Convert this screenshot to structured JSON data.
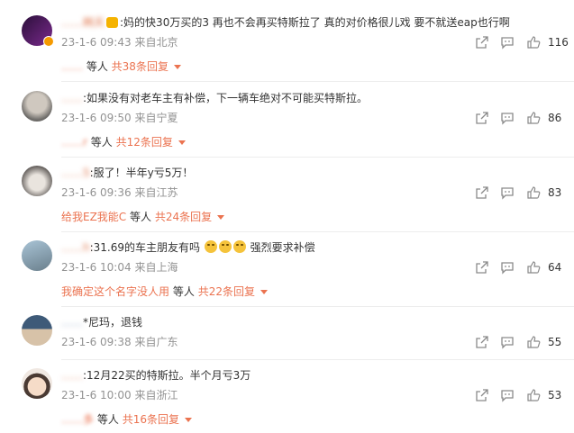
{
  "comments": [
    {
      "author": "……韩天",
      "text": ":妈的快30万买的3 再也不会再买特斯拉了 真的对价格很儿戏 要不就送eap也行啊",
      "time": "23-1-6 09:43",
      "location": "来自北京",
      "likes": "116",
      "reply_user": "……",
      "reply_suffix": "等人",
      "reply_count": "共38条回复"
    },
    {
      "author": "……",
      "text": ":如果没有对老车主有补偿，下一辆车绝对不可能买特斯拉。",
      "time": "23-1-6 09:50",
      "location": "来自宁夏",
      "likes": "86",
      "reply_user": "……r",
      "reply_suffix": "等人",
      "reply_count": "共12条回复"
    },
    {
      "author": "……5",
      "text": ":服了！半年y亏5万！",
      "time": "23-1-6 09:36",
      "location": "来自江苏",
      "likes": "83",
      "reply_user": "给我EZ我能C",
      "reply_suffix": "等人",
      "reply_count": "共24条回复"
    },
    {
      "author": "……h",
      "text": ":31.69的车主朋友有吗",
      "text_after": "强烈要求补偿",
      "time": "23-1-6 10:04",
      "location": "来自上海",
      "likes": "64",
      "reply_user": "我确定这个名字没人用",
      "reply_suffix": "等人",
      "reply_count": "共22条回复"
    },
    {
      "author": "……",
      "text": "*尼玛，退钱",
      "time": "23-1-6 09:38",
      "location": "来自广东",
      "likes": "55"
    },
    {
      "author": "……",
      "text": ":12月22买的特斯拉。半个月亏3万",
      "time": "23-1-6 10:00",
      "location": "来自浙江",
      "likes": "53",
      "reply_user": "……多",
      "reply_suffix": "等人",
      "reply_count": "共16条回复"
    }
  ],
  "colors": {
    "username": "#eb7350",
    "meta": "#939393",
    "text": "#333333",
    "icon": "#8a8a8a"
  },
  "icons": [
    "share-icon",
    "comment-icon",
    "like-icon",
    "vip-badge-icon",
    "crying-emoji-icon",
    "chevron-down-icon"
  ]
}
